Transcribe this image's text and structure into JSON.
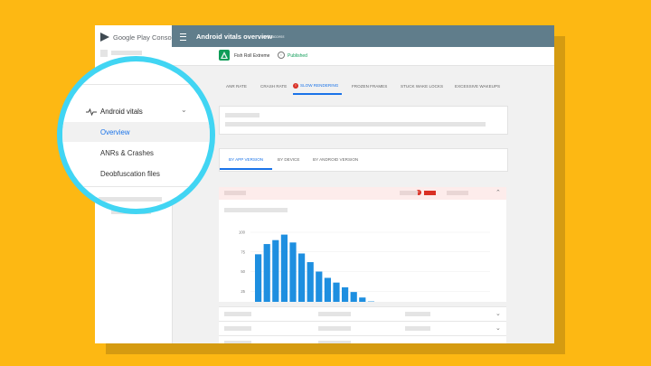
{
  "sidebar": {
    "brand": "Google Play Console",
    "items": [
      {
        "label": "Android vitals",
        "icon": "vitals-icon"
      },
      {
        "label": "Overview"
      },
      {
        "label": "ANRs & Crashes"
      },
      {
        "label": "Deobfuscation files"
      }
    ]
  },
  "topbar": {
    "title": "Android vitals overview",
    "subtitle": "Early access",
    "menu_icon": "menu-icon"
  },
  "app": {
    "name": "Fish Roll Extreme",
    "status": "Published",
    "status_color": "#0f9d58",
    "icon_color": "#0f9d58"
  },
  "tabs": [
    {
      "label": "ANR RATE"
    },
    {
      "label": "CRASH RATE"
    },
    {
      "label": "SLOW RENDERING",
      "active": true,
      "warning": "!"
    },
    {
      "label": "FROZEN FRAMES"
    },
    {
      "label": "STUCK WAKE LOCKS"
    },
    {
      "label": "EXCESSIVE WAKEUPS"
    }
  ],
  "subtabs": [
    {
      "label": "BY APP VERSION",
      "active": true
    },
    {
      "label": "BY DEVICE"
    },
    {
      "label": "BY ANDROID VERSION"
    }
  ],
  "error_badge": "!",
  "colors": {
    "accent": "#1a73e8",
    "error": "#d93025",
    "bar": "#1e8fe0",
    "highlight_ring": "#41d5f3",
    "background": "#FDB813",
    "topbar": "#607d8b"
  },
  "chart_data": {
    "type": "bar",
    "yticks": [
      "100",
      "75",
      "50",
      "25",
      "0"
    ],
    "ylim": [
      0,
      100
    ],
    "xticks": [
      "16ms",
      "100ms",
      "700ms"
    ],
    "values": [
      72,
      85,
      90,
      97,
      87,
      73,
      62,
      50,
      42,
      36,
      30,
      24,
      17,
      12,
      8,
      5,
      5,
      6,
      6,
      10,
      10,
      9,
      5
    ]
  }
}
